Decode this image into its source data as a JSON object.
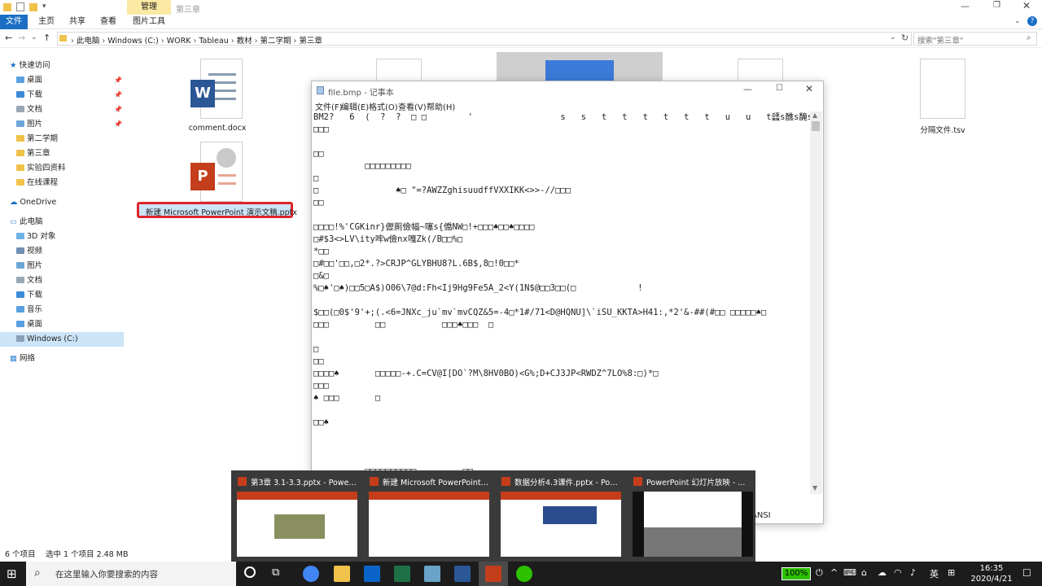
{
  "titlebar": {
    "title": "第三章",
    "manage_label": "管理"
  },
  "ribbon": {
    "tabs": [
      "文件",
      "主页",
      "共享",
      "查看",
      "图片工具"
    ]
  },
  "address": {
    "path": [
      "此电脑",
      "Windows (C:)",
      "WORK",
      "Tableau",
      "教材",
      "第二学期",
      "第三章"
    ],
    "search_placeholder": "搜索\"第三章\""
  },
  "nav": {
    "quick_access": "快速访问",
    "quick_items": [
      {
        "label": "桌面",
        "pinned": true
      },
      {
        "label": "下载",
        "pinned": true
      },
      {
        "label": "文档",
        "pinned": true
      },
      {
        "label": "图片",
        "pinned": true
      },
      {
        "label": "第二学期",
        "pinned": false
      },
      {
        "label": "第三章",
        "pinned": false
      },
      {
        "label": "实验四资料",
        "pinned": false
      },
      {
        "label": "在线课程",
        "pinned": false
      }
    ],
    "onedrive": "OneDrive",
    "this_pc": "此电脑",
    "pc_items": [
      "3D 对象",
      "视频",
      "图片",
      "文档",
      "下载",
      "音乐",
      "桌面",
      "Windows (C:)"
    ],
    "network": "网络"
  },
  "files": {
    "comment": "comment.docx",
    "pptx": "新建 Microsoft PowerPoint 演示文稿.pptx",
    "tsv": "分隔文件.tsv"
  },
  "notepad": {
    "title": "file.bmp - 记事本",
    "menu": [
      "文件(F)",
      "编辑(E)",
      "格式(O)",
      "查看(V)",
      "帮助(H)"
    ],
    "lines": [
      "BM2?   6  (  ?  ?  □ □        '                 s   s   t   t   t   t   t   t   u   u   t瓥s醮s馣s馭s醮u瓥w   y   |   ~",
      "□□□",
      "",
      "□□",
      "          □□□□□□□□□",
      "□",
      "□               ♠□ \"=?AWZZghisuudffVXXIKK<>>-//□□□",
      "□□",
      "",
      "□□□□!%'CGKinr}儮厠儉幅~噻s{僑NW□!+□□□♠□□♠□□□□",
      "□#$3<>LV\\ity哰w儉nx嘎Zk(/B□□%□",
      "*□□",
      "□#□□'□□,□2*.?>CRJP^GLYBHU8?L.6B$,8□!0□□*",
      "□&□",
      "%□♠'□♠)□□5□A$)O06\\7@d:Fh<Ij9Hg9Fe5A_2<Y(1N$@□□3□□(□            !",
      "",
      "$□□(□0$'9'+;(.<6=JNXc_ju`mv`mvCQZ&5=-4□*1#/71<D@HQNU]\\`iSU_KKTA>H41:,*2'&-##(#□□ □□□□□♠□",
      "□□□         □□           □□□♠□□□  □",
      "",
      "□",
      "□□",
      "□□□□♠       □□□□□-+.C=CV@I[DO`?M\\8HV0BO)<G%;D+CJ3JP<RWDZ^7LO%8:□)*□",
      "□□□",
      "♠ □□□       □",
      "",
      "□□♠",
      "",
      "",
      "",
      "          □□□□□□□□□□         □□"
    ],
    "encoding": "ANSI"
  },
  "previews": [
    {
      "title": "第3章 3.1-3.3.pptx - PowerP..."
    },
    {
      "title": "新建 Microsoft PowerPoint ..."
    },
    {
      "title": "数据分析4.3课件.pptx - Powe..."
    },
    {
      "title": "PowerPoint 幻灯片放映 - ..."
    }
  ],
  "status": {
    "count": "6 个项目",
    "selected": "选中 1 个项目  2.48 MB"
  },
  "taskbar": {
    "search_placeholder": "在这里输入你要搜索的内容",
    "battery": "100%",
    "ime": "英",
    "time": "16:35",
    "date": "2020/4/21"
  }
}
